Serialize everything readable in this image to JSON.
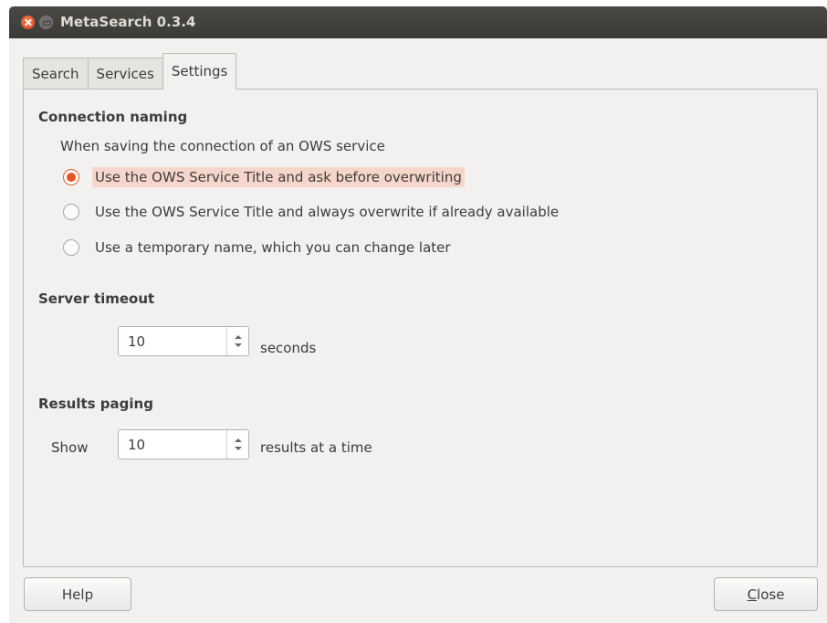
{
  "window": {
    "title": "MetaSearch 0.3.4"
  },
  "tabs": [
    {
      "label": "Search",
      "active": false
    },
    {
      "label": "Services",
      "active": false
    },
    {
      "label": "Settings",
      "active": true
    }
  ],
  "connection_naming": {
    "title": "Connection naming",
    "description": "When saving the connection of an OWS service",
    "options": [
      {
        "label": "Use the OWS Service Title and ask before overwriting",
        "checked": true
      },
      {
        "label": "Use the OWS Service Title and always overwrite if already available",
        "checked": false
      },
      {
        "label": "Use a temporary name, which you can change later",
        "checked": false
      }
    ]
  },
  "server_timeout": {
    "title": "Server timeout",
    "value": "10",
    "unit": "seconds"
  },
  "results_paging": {
    "title": "Results paging",
    "prefix": "Show",
    "value": "10",
    "suffix": "results at a time"
  },
  "buttons": {
    "help": "Help",
    "close_mnemonic": "C",
    "close_rest": "lose"
  },
  "colors": {
    "accent": "#e95420",
    "selection_highlight": "#f6d6cb",
    "titlebar": "#3c3b37",
    "window_bg": "#f2f1f0"
  }
}
